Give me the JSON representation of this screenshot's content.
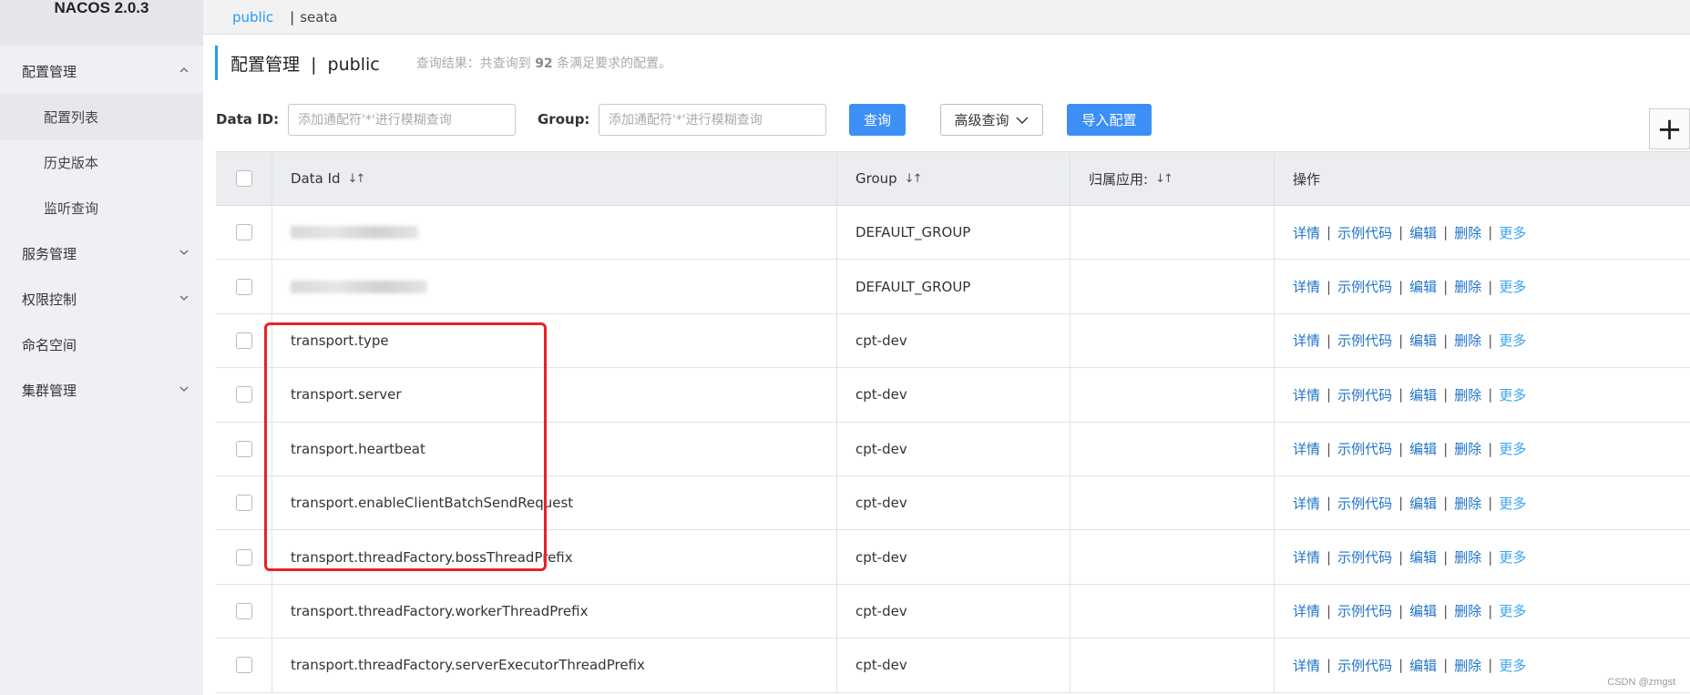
{
  "brand": "NACOS 2.0.3",
  "sidebar": {
    "items": [
      {
        "label": "配置管理",
        "expanded": true
      },
      {
        "label": "配置列表",
        "sub": true,
        "active": true
      },
      {
        "label": "历史版本",
        "sub": true
      },
      {
        "label": "监听查询",
        "sub": true
      },
      {
        "label": "服务管理",
        "expanded": false
      },
      {
        "label": "权限控制",
        "expanded": false
      },
      {
        "label": "命名空间"
      },
      {
        "label": "集群管理",
        "expanded": false
      }
    ]
  },
  "namespaces": {
    "active": "public",
    "separator": "|",
    "other": "seata"
  },
  "header": {
    "title": "配置管理  |  public",
    "result_prefix": "查询结果：共查询到 ",
    "result_count": "92",
    "result_suffix": " 条满足要求的配置。"
  },
  "filters": {
    "data_id_label": "Data ID:",
    "data_id_placeholder": "添加通配符'*'进行模糊查询",
    "group_label": "Group:",
    "group_placeholder": "添加通配符'*'进行模糊查询",
    "query_button": "查询",
    "advanced_button": "高级查询",
    "import_button": "导入配置"
  },
  "table": {
    "headers": {
      "data_id": "Data Id",
      "group": "Group",
      "app": "归属应用:",
      "ops": "操作"
    },
    "ops": {
      "detail": "详情",
      "sample": "示例代码",
      "edit": "编辑",
      "delete": "删除",
      "more": "更多"
    },
    "rows": [
      {
        "data_id": "",
        "group": "DEFAULT_GROUP",
        "app": "",
        "redacted": true
      },
      {
        "data_id": "",
        "group": "DEFAULT_GROUP",
        "app": "",
        "redacted": true
      },
      {
        "data_id": "transport.type",
        "group": "cpt-dev",
        "app": ""
      },
      {
        "data_id": "transport.server",
        "group": "cpt-dev",
        "app": ""
      },
      {
        "data_id": "transport.heartbeat",
        "group": "cpt-dev",
        "app": ""
      },
      {
        "data_id": "transport.enableClientBatchSendRequest",
        "group": "cpt-dev",
        "app": ""
      },
      {
        "data_id": "transport.threadFactory.bossThreadPrefix",
        "group": "cpt-dev",
        "app": ""
      },
      {
        "data_id": "transport.threadFactory.workerThreadPrefix",
        "group": "cpt-dev",
        "app": ""
      },
      {
        "data_id": "transport.threadFactory.serverExecutorThreadPrefix",
        "group": "cpt-dev",
        "app": ""
      }
    ]
  },
  "watermark": "CSDN @zmgst",
  "colors": {
    "accent": "#209bfa",
    "primary_button": "#3d8ff5",
    "link": "#1f73c9",
    "highlight": "#e82127"
  }
}
